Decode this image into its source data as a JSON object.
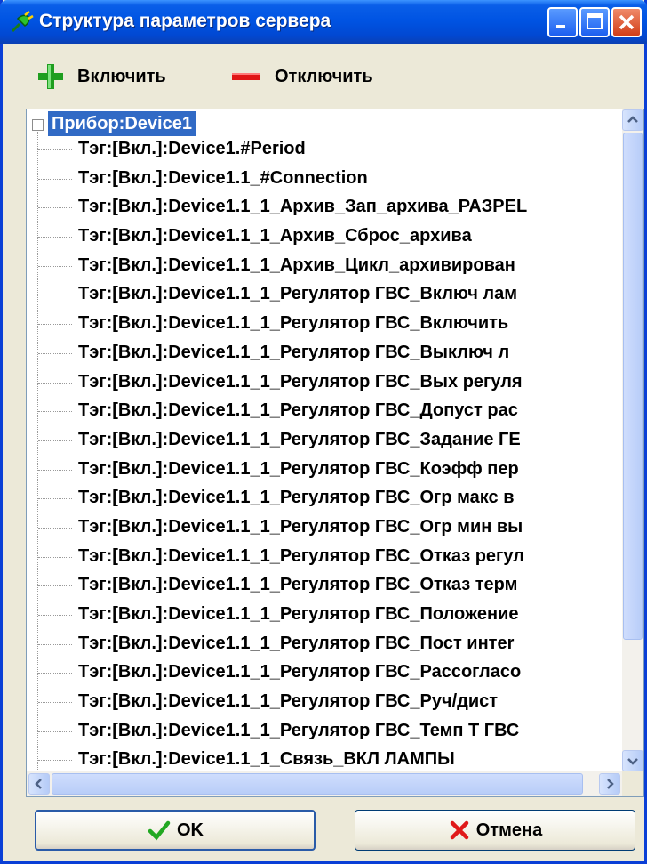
{
  "window": {
    "title": "Структура параметров сервера",
    "icon": "plug-icon"
  },
  "toolbar": {
    "enable_label": "Включить",
    "disable_label": "Отключить",
    "enable_color": "#1f9e1f",
    "disable_color": "#e01515"
  },
  "tree": {
    "root_label": "Прибор:Device1",
    "items": [
      "Тэг:[Вкл.]:Device1.#Period",
      "Тэг:[Вкл.]:Device1.1_#Connection",
      "Тэг:[Вкл.]:Device1.1_1_Архив_Зап_архива_РАЗРЕL",
      "Тэг:[Вкл.]:Device1.1_1_Архив_Сброс_архива",
      "Тэг:[Вкл.]:Device1.1_1_Архив_Цикл_архивирован",
      "Тэг:[Вкл.]:Device1.1_1_Регулятор ГВС_Включ лам",
      "Тэг:[Вкл.]:Device1.1_1_Регулятор ГВС_Включить",
      "Тэг:[Вкл.]:Device1.1_1_Регулятор ГВС_Выключ л",
      "Тэг:[Вкл.]:Device1.1_1_Регулятор ГВС_Вых регуля",
      "Тэг:[Вкл.]:Device1.1_1_Регулятор ГВС_Допуст рас",
      "Тэг:[Вкл.]:Device1.1_1_Регулятор ГВС_Задание ГЕ",
      "Тэг:[Вкл.]:Device1.1_1_Регулятор ГВС_Коэфф пер",
      "Тэг:[Вкл.]:Device1.1_1_Регулятор ГВС_Огр макс в",
      "Тэг:[Вкл.]:Device1.1_1_Регулятор ГВС_Огр мин вы",
      "Тэг:[Вкл.]:Device1.1_1_Регулятор ГВС_Отказ регул",
      "Тэг:[Вкл.]:Device1.1_1_Регулятор ГВС_Отказ терм",
      "Тэг:[Вкл.]:Device1.1_1_Регулятор ГВС_Положение",
      "Тэг:[Вкл.]:Device1.1_1_Регулятор ГВС_Пост интеr",
      "Тэг:[Вкл.]:Device1.1_1_Регулятор ГВС_Рассогласо",
      "Тэг:[Вкл.]:Device1.1_1_Регулятор ГВС_Руч/дист",
      "Тэг:[Вкл.]:Device1.1_1_Регулятор ГВС_Темп Т ГВС",
      "Тэг:[Вкл.]:Device1.1_1_Связь_ВКЛ ЛАМПЫ"
    ]
  },
  "buttons": {
    "ok_label": "OK",
    "cancel_label": "Отмена",
    "ok_color": "#22a822",
    "cancel_color": "#e01a1a"
  }
}
